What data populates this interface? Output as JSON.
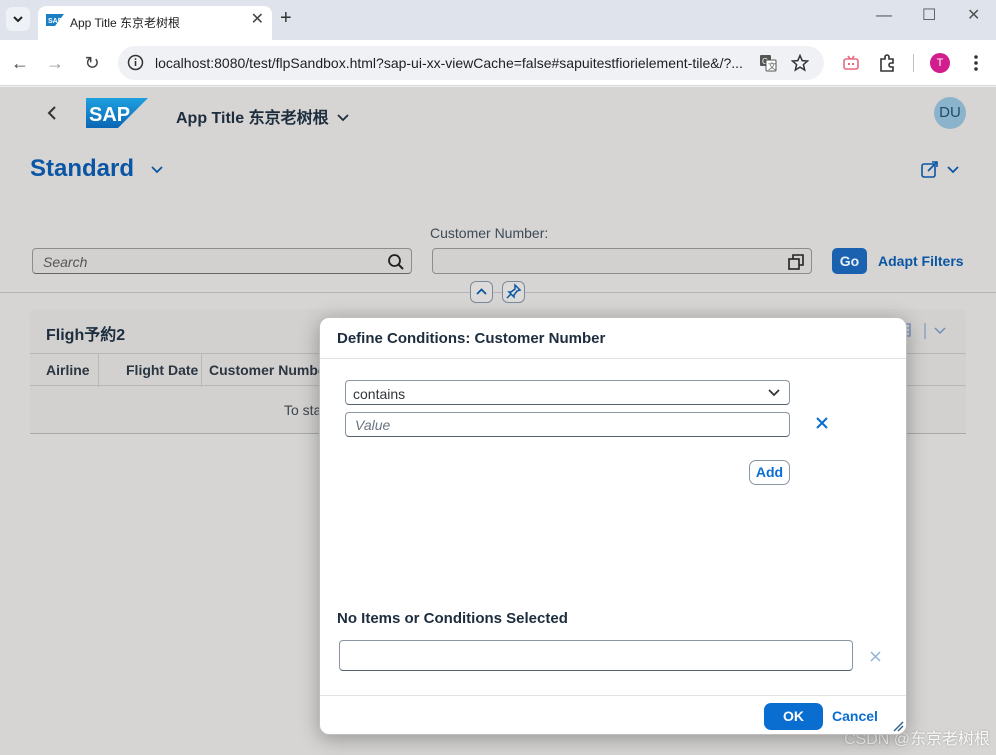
{
  "browser": {
    "tab_title": "App Title 东京老树根",
    "url": "localhost:8080/test/flpSandbox.html?sap-ui-xx-viewCache=false#sapuitestfiorielement-tile&/?...",
    "profile_initial": "T"
  },
  "shell": {
    "logo_text": "SAP",
    "app_title": "App Title 东京老树根",
    "user_initials": "DU"
  },
  "page": {
    "variant": "Standard",
    "filter_label": "Customer Number:",
    "search_placeholder": "Search",
    "go_label": "Go",
    "adapt_filters_label": "Adapt Filters"
  },
  "table": {
    "title": "Fligh予約2",
    "columns": [
      "Airline",
      "Flight Date",
      "Customer Number"
    ],
    "no_data_text": "To sta"
  },
  "dialog": {
    "title": "Define Conditions: Customer Number",
    "operator": "contains",
    "value_placeholder": "Value",
    "add_label": "Add",
    "selected_heading": "No Items or Conditions Selected",
    "ok_label": "OK",
    "cancel_label": "Cancel"
  },
  "watermark": "CSDN @东京老树根",
  "colors": {
    "brand_blue": "#0a6ed1",
    "title_blue": "#0a56a4",
    "go_blue": "#1a62b0",
    "sap_logo": "#1b7fc4"
  }
}
